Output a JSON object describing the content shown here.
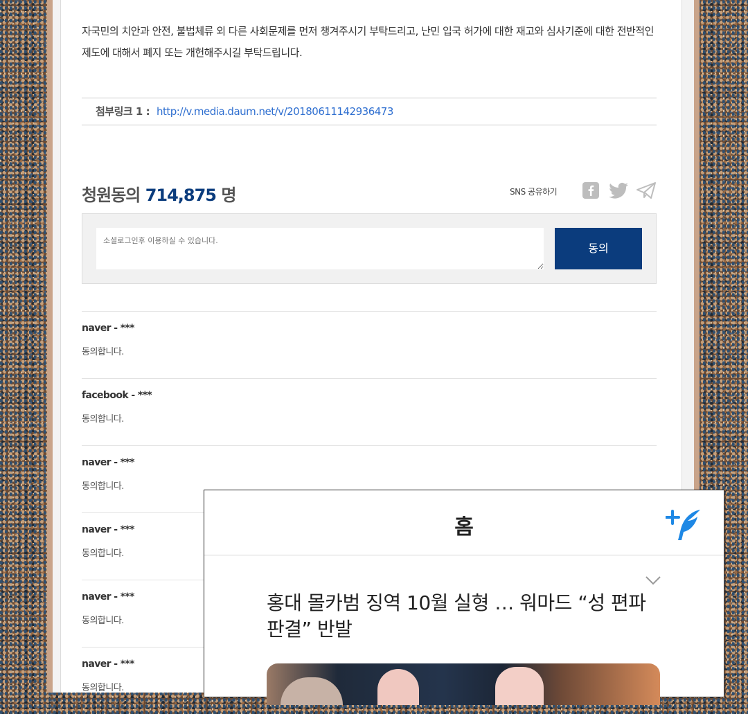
{
  "petition": {
    "body_text": "자국민의 치안과 안전, 불법체류 외 다른 사회문제를 먼저 챙겨주시기 부탁드리고, 난민 입국 허가에 대한 재고와 심사기준에 대한 전반적인 제도에 대해서 폐지 또는 개헌해주시길 부탁드립니다.",
    "attachment_label": "첨부링크 1 :",
    "attachment_url": "http://v.media.daum.net/v/20180611142936473",
    "signature_prefix": "청원동의",
    "signature_count": "714,875",
    "signature_unit": "명",
    "sns_label": "SNS 공유하기",
    "input_placeholder": "소셜로그인후 이용하실 수 있습니다.",
    "agree_button": "동의"
  },
  "comments": [
    {
      "author": "naver - ***",
      "text": "동의합니다."
    },
    {
      "author": "facebook - ***",
      "text": "동의합니다."
    },
    {
      "author": "naver - ***",
      "text": "동의합니다."
    },
    {
      "author": "naver - ***",
      "text": "동의합니다."
    },
    {
      "author": "naver - ***",
      "text": "동의합니다."
    },
    {
      "author": "naver - ***",
      "text": "동의합니다."
    }
  ],
  "overlay": {
    "title": "홈",
    "headline": "홍대 몰카범 징역 10월 실형 … 워마드 “성 편파 판결” 반발"
  },
  "colors": {
    "accent": "#0b3c7d",
    "link": "#2f6fd0",
    "write_icon": "#1e88e5"
  },
  "icons": [
    "facebook-icon",
    "twitter-icon",
    "telegram-icon",
    "write-quill-icon",
    "chevron-down-icon"
  ]
}
